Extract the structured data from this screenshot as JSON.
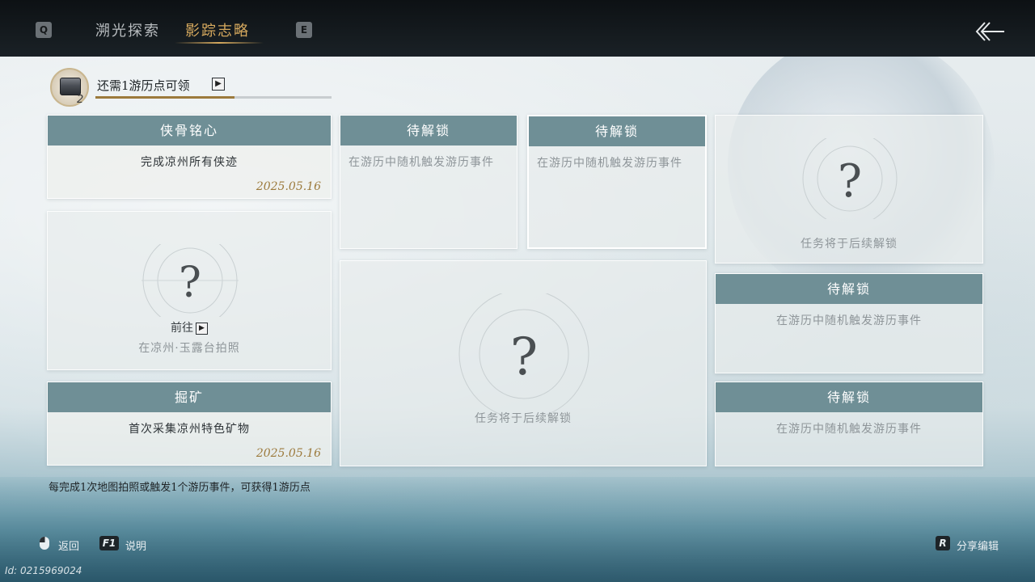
{
  "topbar": {
    "left_key": "Q",
    "right_key": "E",
    "tabs": [
      {
        "label": "溯光探索",
        "active": false
      },
      {
        "label": "影踪志略",
        "active": true
      }
    ]
  },
  "progress": {
    "count": "2",
    "text": "还需1游历点可领",
    "fill_fraction": 0.59
  },
  "cards": {
    "c1": {
      "title": "侠骨铭心",
      "desc": "完成凉州所有侠迹",
      "date": "2025.05.16"
    },
    "c2": {
      "goto_label": "前往",
      "caption": "在凉州·玉露台拍照"
    },
    "c3": {
      "title": "掘矿",
      "desc": "首次采集凉州特色矿物",
      "date": "2025.05.16"
    },
    "c4": {
      "title": "待解锁",
      "desc": "在游历中随机触发游历事件"
    },
    "c5": {
      "title": "待解锁",
      "desc": "在游历中随机触发游历事件"
    },
    "c6": {
      "caption": "任务将于后续解锁"
    },
    "c7": {
      "caption": "任务将于后续解锁"
    },
    "c8": {
      "title": "待解锁",
      "desc": "在游历中随机触发游历事件"
    },
    "c9": {
      "title": "待解锁",
      "desc": "在游历中随机触发游历事件"
    }
  },
  "footnote": "每完成1次地图拍照或触发1个游历事件，可获得1游历点",
  "bottom": {
    "back_label": "返回",
    "help_key": "F1",
    "help_label": "说明",
    "share_key": "R",
    "share_label": "分享编辑"
  },
  "uid": "Id: 0215969024",
  "colors": {
    "accent_gold": "#d6a95e",
    "header_teal": "#6f8f96",
    "date_gold": "#9c7a3c"
  }
}
